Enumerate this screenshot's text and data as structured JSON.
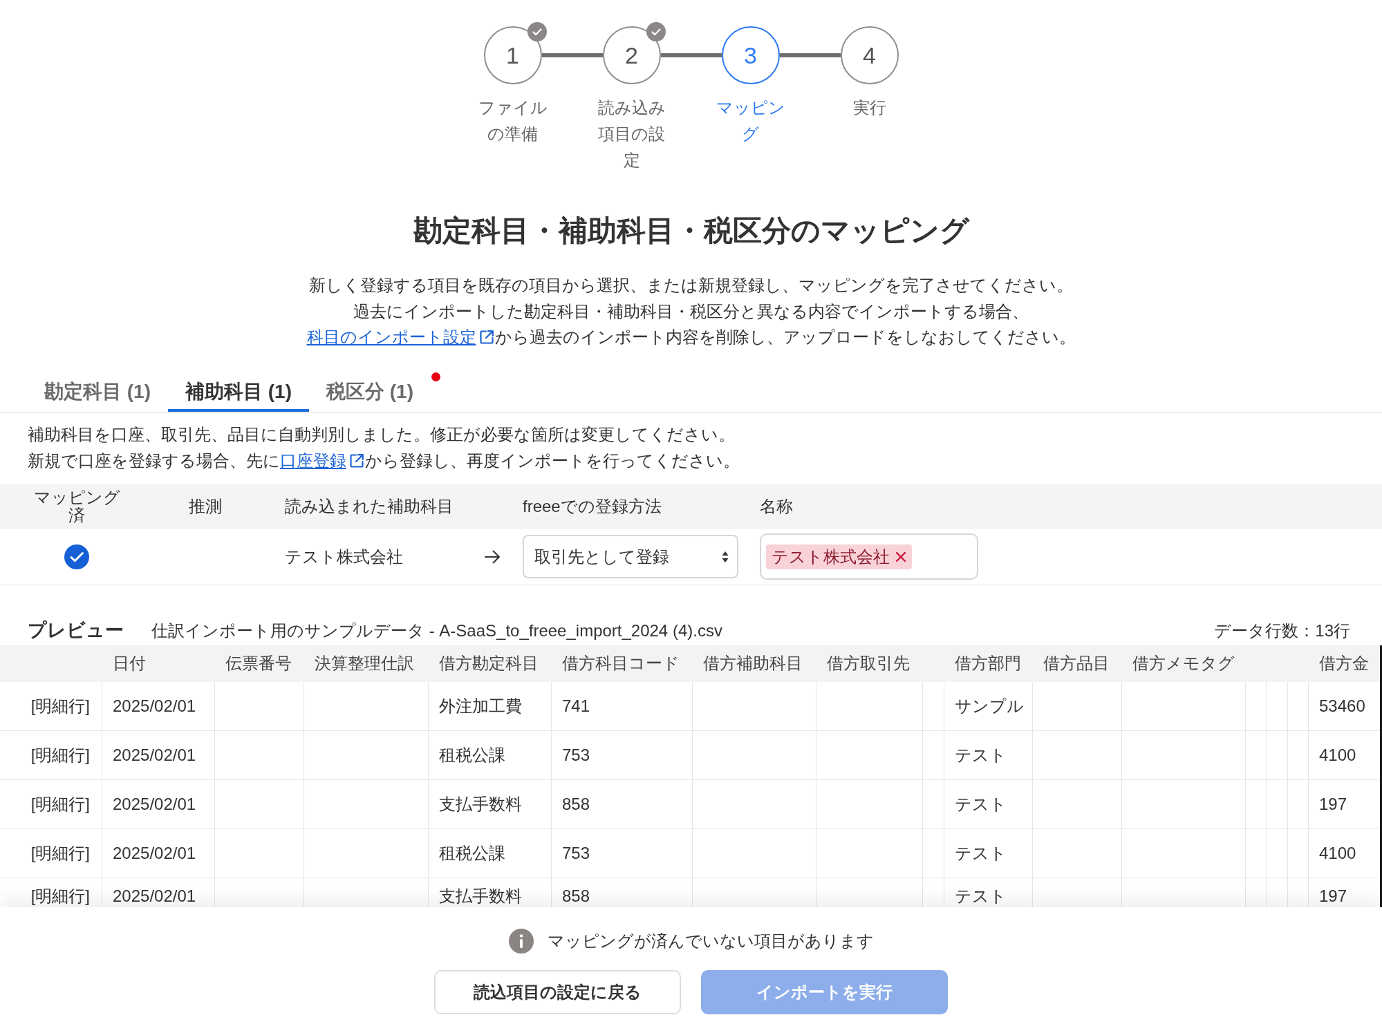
{
  "steps": [
    {
      "number": "1",
      "label": "ファイルの準備",
      "done": true,
      "selected": false
    },
    {
      "number": "2",
      "label": "読み込み項目の設定",
      "done": true,
      "selected": false
    },
    {
      "number": "3",
      "label": "マッピング",
      "done": false,
      "selected": true
    },
    {
      "number": "4",
      "label": "実行",
      "done": false,
      "selected": false
    }
  ],
  "title": "勘定科目・補助科目・税区分のマッピング",
  "description": {
    "lines": [
      "新しく登録する項目を既存の項目から選択、または新規登録し、マッピングを完了させてください。",
      "過去にインポートした勘定科目・補助科目・税区分と異なる内容でインポートする場合、"
    ],
    "link": "科目のインポート設定",
    "after_link": "から過去のインポート内容を削除し、アップロードをしなおしてください。"
  },
  "tabs": [
    {
      "label": "勘定科目 (1)",
      "selected": false,
      "alert": false
    },
    {
      "label": "補助科目 (1)",
      "selected": true,
      "alert": false
    },
    {
      "label": "税区分 (1)",
      "selected": false,
      "alert": true
    }
  ],
  "notice_text": {
    "line": "補助科目を口座、取引先、品目に自動判別しました。修正が必要な箇所は変更してください。",
    "before_link": "新規で口座を登録する場合、先に",
    "link": "口座登録",
    "after_link": "から登録し、再度インポートを行ってください。"
  },
  "mapping_table": {
    "columns": [
      "マッピング済",
      "推測",
      "読み込まれた補助科目",
      "freeeでの登録方法",
      "名称"
    ],
    "rows": [
      {
        "mapped": true,
        "imported": "テスト株式会社",
        "method": "取引先として登録",
        "names": [
          "テスト株式会社"
        ]
      }
    ]
  },
  "preview": {
    "title": "プレビュー",
    "file": "仕訳インポート用のサンプルデータ - A-SaaS_to_freee_import_2024 (4).csv",
    "row_count": "データ行数：13行",
    "columns": [
      null,
      "日付",
      "伝票番号",
      "決算整理仕訳",
      "借方勘定科目",
      "借方科目コード",
      "借方補助科目",
      "借方取引先",
      null,
      "借方部門",
      "借方品目",
      "借方メモタグ",
      null,
      null,
      null,
      "借方金"
    ],
    "rows": [
      [
        "[明細行]",
        "2025/02/01",
        null,
        null,
        "外注加工費",
        "741",
        null,
        null,
        null,
        "サンプル",
        null,
        null,
        null,
        null,
        null,
        "53460"
      ],
      [
        "[明細行]",
        "2025/02/01",
        null,
        null,
        "租税公課",
        "753",
        null,
        null,
        null,
        "テスト",
        null,
        null,
        null,
        null,
        null,
        "4100"
      ],
      [
        "[明細行]",
        "2025/02/01",
        null,
        null,
        "支払手数料",
        "858",
        null,
        null,
        null,
        "テスト",
        null,
        null,
        null,
        null,
        null,
        "197"
      ],
      [
        "[明細行]",
        "2025/02/01",
        null,
        null,
        "租税公課",
        "753",
        null,
        null,
        null,
        "テスト",
        null,
        null,
        null,
        null,
        null,
        "4100"
      ],
      [
        "[明細行]",
        "2025/02/01",
        null,
        null,
        "支払手数料",
        "858",
        null,
        null,
        null,
        "テスト",
        null,
        null,
        null,
        null,
        null,
        "197"
      ]
    ]
  },
  "footer": {
    "notice": "マッピングが済んでいない項目があります",
    "buttons": [
      {
        "label": "読込項目の設定に戻る",
        "kind": "secondary",
        "disabled": false
      },
      {
        "label": "インポートを実行",
        "kind": "primary",
        "disabled": true
      }
    ]
  }
}
